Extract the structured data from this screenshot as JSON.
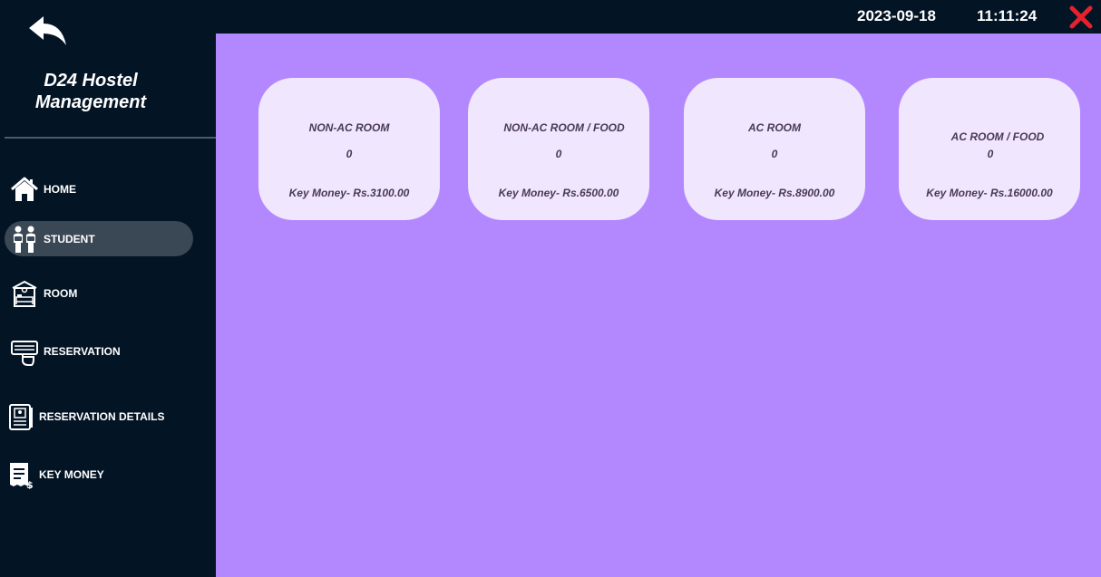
{
  "header": {
    "date": "2023-09-18",
    "time": "11:11:24"
  },
  "brand": {
    "line1": "D24 Hostel",
    "line2": "Management"
  },
  "sidebar": {
    "items": [
      {
        "label": "HOME",
        "icon": "home-icon",
        "active": false
      },
      {
        "label": "STUDENT",
        "icon": "students-icon",
        "active": true
      },
      {
        "label": "ROOM",
        "icon": "room-icon",
        "active": false
      },
      {
        "label": "RESERVATION",
        "icon": "booking-icon",
        "active": false
      },
      {
        "label": "RESERVATION DETAILS",
        "icon": "reservation-details-icon",
        "active": false
      },
      {
        "label": "KEY MONEY",
        "icon": "receipt-icon",
        "active": false
      }
    ]
  },
  "cards": [
    {
      "title": "NON-AC ROOM",
      "count": "0",
      "price": "Key Money- Rs.3100.00"
    },
    {
      "title": "NON-AC ROOM / FOOD",
      "count": "0",
      "price": "Key Money- Rs.6500.00"
    },
    {
      "title": "AC ROOM",
      "count": "0",
      "price": "Key Money- Rs.8900.00"
    },
    {
      "title": "AC ROOM / FOOD",
      "count": "0",
      "price": "Key Money- Rs.16000.00"
    }
  ],
  "colors": {
    "sidebar": "#031425",
    "main": "#b388ff",
    "card": "#f0e6fd",
    "active_item": "#3a4754",
    "close": "#e5212d"
  }
}
